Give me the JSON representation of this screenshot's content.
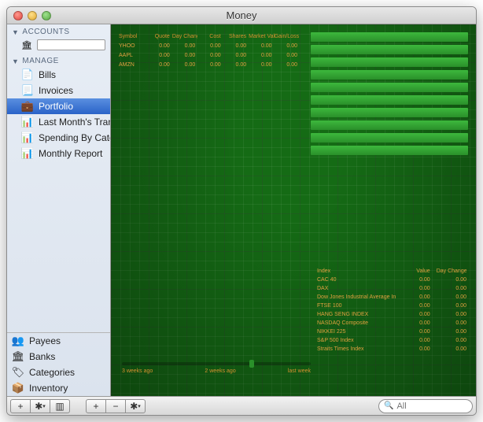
{
  "window": {
    "title": "Money"
  },
  "sidebar": {
    "sections": {
      "accounts_label": "ACCOUNTS",
      "manage_label": "MANAGE"
    },
    "manage_items": [
      {
        "label": "Bills",
        "icon": "📄",
        "name": "sidebar-item-bills"
      },
      {
        "label": "Invoices",
        "icon": "📃",
        "name": "sidebar-item-invoices"
      },
      {
        "label": "Portfolio",
        "icon": "💼",
        "name": "sidebar-item-portfolio",
        "selected": true
      },
      {
        "label": "Last Month's Tran",
        "icon": "📊",
        "name": "sidebar-item-last-months-transactions"
      },
      {
        "label": "Spending By Cate",
        "icon": "📊",
        "name": "sidebar-item-spending-by-category"
      },
      {
        "label": "Monthly Report",
        "icon": "📊",
        "name": "sidebar-item-monthly-report"
      }
    ],
    "bottom_items": [
      {
        "label": "Payees",
        "icon": "👥",
        "name": "sidebar-item-payees"
      },
      {
        "label": "Banks",
        "icon": "🏛",
        "name": "sidebar-item-banks"
      },
      {
        "label": "Categories",
        "icon": "🏷",
        "name": "sidebar-item-categories"
      },
      {
        "label": "Inventory",
        "icon": "📦",
        "name": "sidebar-item-inventory"
      }
    ]
  },
  "portfolio": {
    "columns": [
      "Symbol",
      "Quote",
      "Day Change",
      "Cost",
      "Shares",
      "Market Value",
      "Gain/Loss"
    ],
    "rows": [
      {
        "symbol": "YHOO",
        "quote": "0.00",
        "day_change": "0.00",
        "cost": "0.00",
        "shares": "0.00",
        "market_value": "0.00",
        "gain_loss": "0.00"
      },
      {
        "symbol": "AAPL",
        "quote": "0.00",
        "day_change": "0.00",
        "cost": "0.00",
        "shares": "0.00",
        "market_value": "0.00",
        "gain_loss": "0.00"
      },
      {
        "symbol": "AMZN",
        "quote": "0.00",
        "day_change": "0.00",
        "cost": "0.00",
        "shares": "0.00",
        "market_value": "0.00",
        "gain_loss": "0.00"
      }
    ]
  },
  "indices": {
    "columns": [
      "Index",
      "Value",
      "Day Change"
    ],
    "rows": [
      {
        "name": "CAC 40",
        "value": "0.00",
        "change": "0.00"
      },
      {
        "name": "DAX",
        "value": "0.00",
        "change": "0.00"
      },
      {
        "name": "Dow Jones Industrial Average In",
        "value": "0.00",
        "change": "0.00"
      },
      {
        "name": "FTSE 100",
        "value": "0.00",
        "change": "0.00"
      },
      {
        "name": "HANG SENG INDEX",
        "value": "0.00",
        "change": "0.00"
      },
      {
        "name": "NASDAQ Composite",
        "value": "0.00",
        "change": "0.00"
      },
      {
        "name": "NIKKEI 225",
        "value": "0.00",
        "change": "0.00"
      },
      {
        "name": "S&P 500 Index",
        "value": "0.00",
        "change": "0.00"
      },
      {
        "name": "Straits Times Index",
        "value": "0.00",
        "change": "0.00"
      }
    ]
  },
  "timeline": {
    "labels": [
      "3 weeks ago",
      "2 weeks ago",
      "last week"
    ]
  },
  "toolbar": {
    "add": "+",
    "remove": "−",
    "gear": "✱",
    "columns": "▥"
  },
  "search": {
    "placeholder": "All",
    "icon": "🔍"
  },
  "chart_data": {
    "type": "bar",
    "categories": [
      "",
      "",
      "",
      "",
      "",
      "",
      "",
      "",
      "",
      ""
    ],
    "values": [
      1,
      1,
      1,
      1,
      1,
      1,
      1,
      1,
      1,
      1
    ],
    "title": "",
    "xlabel": "",
    "ylabel": "",
    "ylim": [
      0,
      1
    ]
  }
}
